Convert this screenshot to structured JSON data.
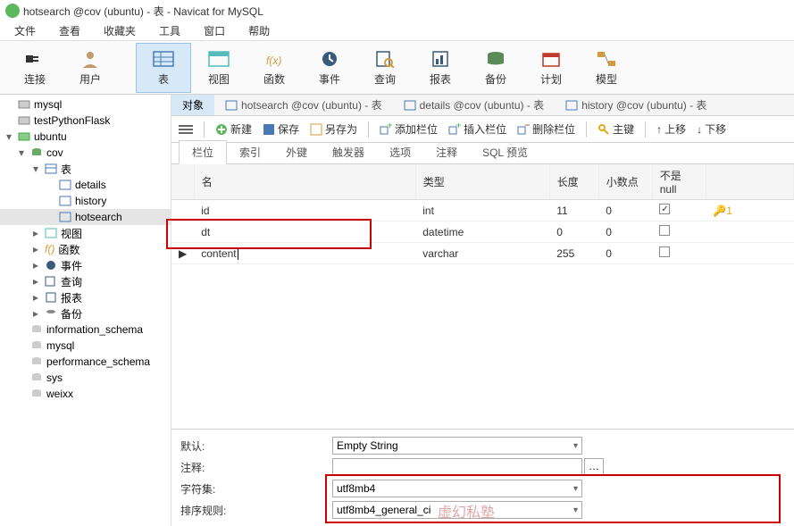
{
  "window": {
    "title": "hotsearch @cov (ubuntu) - 表 - Navicat for MySQL"
  },
  "menu": [
    "文件",
    "查看",
    "收藏夹",
    "工具",
    "窗口",
    "帮助"
  ],
  "main_toolbar": [
    {
      "name": "connect",
      "label": "连接"
    },
    {
      "name": "user",
      "label": "用户"
    },
    {
      "name": "table",
      "label": "表",
      "active": true
    },
    {
      "name": "view",
      "label": "视图"
    },
    {
      "name": "function",
      "label": "函数"
    },
    {
      "name": "event",
      "label": "事件"
    },
    {
      "name": "query",
      "label": "查询"
    },
    {
      "name": "report",
      "label": "报表"
    },
    {
      "name": "backup",
      "label": "备份"
    },
    {
      "name": "schedule",
      "label": "计划"
    },
    {
      "name": "model",
      "label": "模型"
    }
  ],
  "tree": {
    "items": [
      {
        "label": "mysql",
        "level": 0
      },
      {
        "label": "testPythonFlask",
        "level": 0
      },
      {
        "label": "ubuntu",
        "level": 0,
        "expanded": true
      },
      {
        "label": "cov",
        "level": 1,
        "expanded": true
      },
      {
        "label": "表",
        "level": 2,
        "expanded": true
      },
      {
        "label": "details",
        "level": 3
      },
      {
        "label": "history",
        "level": 3
      },
      {
        "label": "hotsearch",
        "level": 3,
        "selected": true
      },
      {
        "label": "视图",
        "level": 2,
        "collapsed": true
      },
      {
        "label": "函数",
        "level": 2,
        "collapsed": true
      },
      {
        "label": "事件",
        "level": 2,
        "collapsed": true
      },
      {
        "label": "查询",
        "level": 2,
        "collapsed": true
      },
      {
        "label": "报表",
        "level": 2,
        "collapsed": true
      },
      {
        "label": "备份",
        "level": 2,
        "collapsed": true
      },
      {
        "label": "information_schema",
        "level": 1
      },
      {
        "label": "mysql",
        "level": 1
      },
      {
        "label": "performance_schema",
        "level": 1
      },
      {
        "label": "sys",
        "level": 1
      },
      {
        "label": "weixx",
        "level": 1
      }
    ]
  },
  "tabs": [
    {
      "label": "对象",
      "active": true
    },
    {
      "label": "hotsearch @cov (ubuntu) - 表"
    },
    {
      "label": "details @cov (ubuntu) - 表"
    },
    {
      "label": "history @cov (ubuntu) - 表"
    }
  ],
  "toolbar2": {
    "new": "新建",
    "save": "保存",
    "saveas": "另存为",
    "addcol": "添加栏位",
    "insertcol": "插入栏位",
    "delcol": "删除栏位",
    "primary": "主键",
    "up": "上移",
    "down": "下移"
  },
  "subtabs": [
    "栏位",
    "索引",
    "外键",
    "触发器",
    "选项",
    "注释",
    "SQL 预览"
  ],
  "grid": {
    "headers": {
      "name": "名",
      "type": "类型",
      "len": "长度",
      "dec": "小数点",
      "notnull": "不是 null",
      "key": ""
    },
    "rows": [
      {
        "name": "id",
        "type": "int",
        "len": "11",
        "dec": "0",
        "notnull": true,
        "key": "1"
      },
      {
        "name": "dt",
        "type": "datetime",
        "len": "0",
        "dec": "0",
        "notnull": false
      },
      {
        "name": "content",
        "type": "varchar",
        "len": "255",
        "dec": "0",
        "notnull": false,
        "current": true
      }
    ]
  },
  "props": {
    "default_lbl": "默认:",
    "default_val": "Empty String",
    "comment_lbl": "注释:",
    "comment_val": "",
    "charset_lbl": "字符集:",
    "charset_val": "utf8mb4",
    "collation_lbl": "排序规则:",
    "collation_val": "utf8mb4_general_ci"
  },
  "watermark": "虚幻私塾"
}
